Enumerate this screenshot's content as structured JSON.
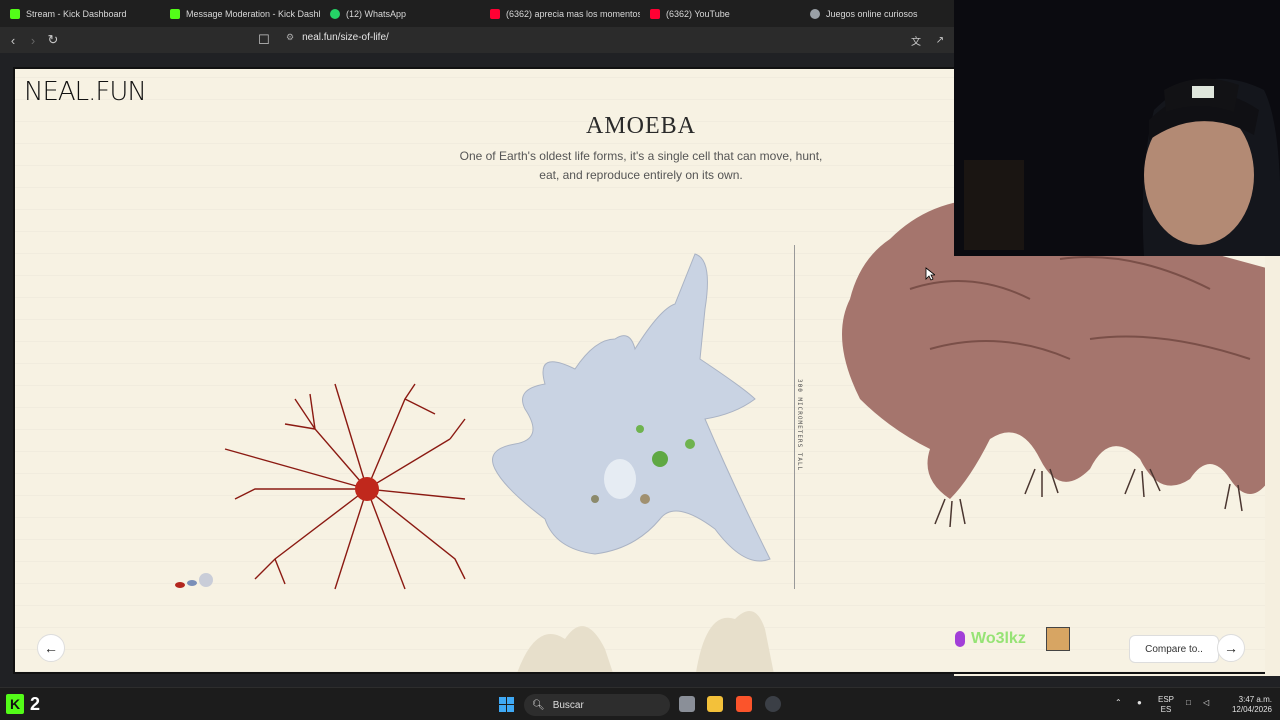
{
  "tabs": [
    {
      "label": "Stream - Kick Dashboard",
      "icon": "kick-icon"
    },
    {
      "label": "Message Moderation - Kick Dashbo",
      "icon": "kick-icon"
    },
    {
      "label": "(12) WhatsApp",
      "icon": "whatsapp-icon"
    },
    {
      "label": "(6362) aprecia mas los momentos n",
      "icon": "youtube-icon"
    },
    {
      "label": "(6362) YouTube",
      "icon": "youtube-icon"
    },
    {
      "label": "Juegos online curiosos",
      "icon": "globe-icon"
    }
  ],
  "address": {
    "url": "neal.fun/size-of-life/"
  },
  "page": {
    "logo": "NEAL.FUN",
    "title": "AMOEBA",
    "description": "One of Earth's oldest life forms, it's a single cell that can move, hunt, eat, and reproduce entirely on its own.",
    "scale_label": "300 MICROMETERS TALL",
    "prev_arrow": "←",
    "next_arrow": "→",
    "compare_label": "Compare to..",
    "overlay_name": "Wo3lkz"
  },
  "taskbar": {
    "kick_count": "2",
    "search_placeholder": "Buscar",
    "lang_top": "ESP",
    "lang_bottom": "ES",
    "time": "3:47 a.m.",
    "date": "12/04/2026"
  },
  "colors": {
    "kick": "#53fc18",
    "page_bg": "#f7f2e3",
    "accent_red": "#8b1a12"
  }
}
